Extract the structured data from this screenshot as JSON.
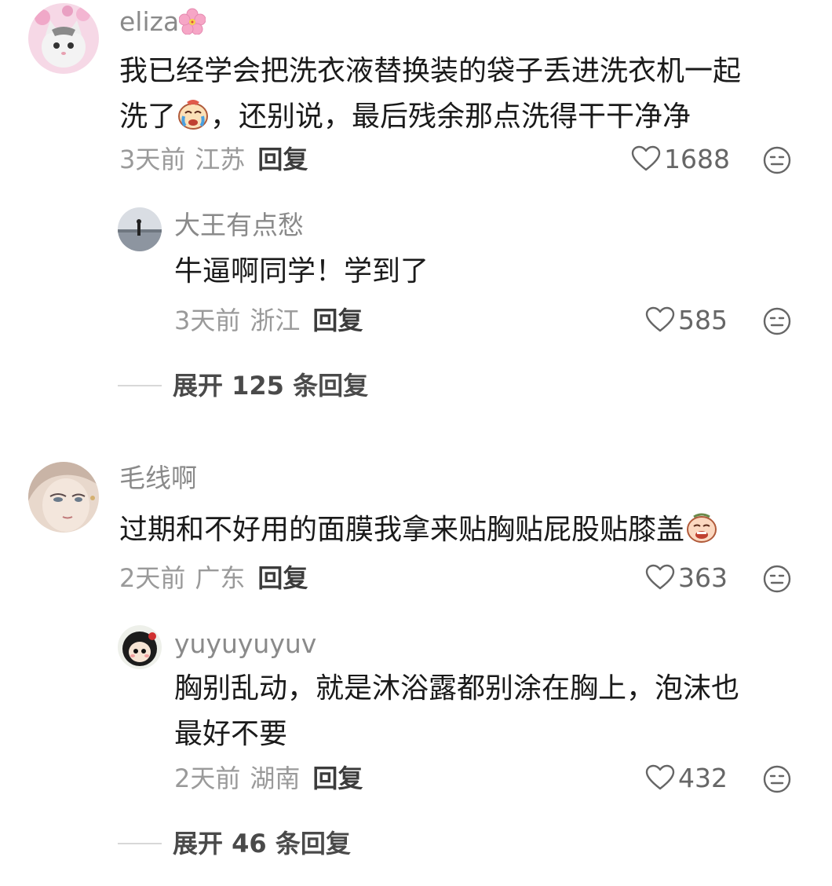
{
  "comments": [
    {
      "username": "eliza",
      "username_emoji": "cherry-blossom",
      "text_line1": "我已经学会把洗衣液替换装的袋子丢进洗衣机一起",
      "text_line2a": "洗了",
      "text_line2b": "，还别说，最后残余那点洗得干干净净",
      "time": "3天前",
      "location": "江苏",
      "reply_label": "回复",
      "likes": "1688",
      "replies": [
        {
          "username": "大王有点愁",
          "text": "牛逼啊同学！学到了",
          "time": "3天前",
          "location": "浙江",
          "reply_label": "回复",
          "likes": "585"
        }
      ],
      "expand_label": "展开 125 条回复"
    },
    {
      "username": "毛线啊",
      "text": "过期和不好用的面膜我拿来贴胸贴屁股贴膝盖",
      "time": "2天前",
      "location": "广东",
      "reply_label": "回复",
      "likes": "363",
      "replies": [
        {
          "username": "yuyuyuyuv",
          "text_line1": "胸别乱动，就是沐浴露都别涂在胸上，泡沫也",
          "text_line2": "最好不要",
          "time": "2天前",
          "location": "湖南",
          "reply_label": "回复",
          "likes": "432"
        }
      ],
      "expand_label": "展开 46 条回复"
    }
  ],
  "icons": {
    "like": "heart-outline-icon",
    "dislike": "meh-face-icon",
    "crying": "crying-face-emoji"
  },
  "colors": {
    "username": "#8a8a8a",
    "text": "#1a1a1a",
    "meta": "#9a9a9a",
    "reply": "#3c3c3c"
  }
}
